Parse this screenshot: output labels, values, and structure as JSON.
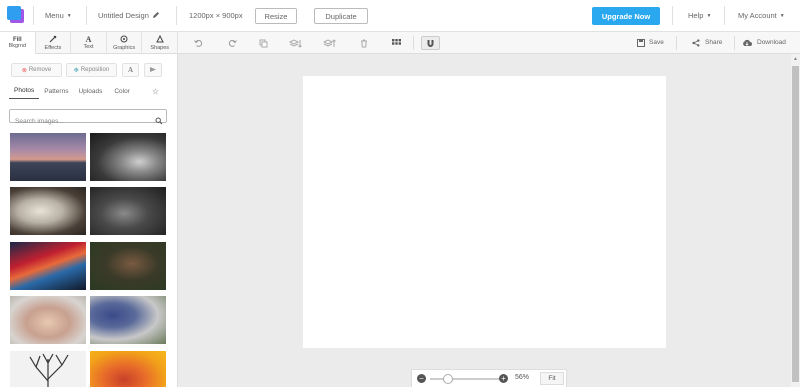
{
  "topbar": {
    "menu_label": "Menu",
    "design_name": "Untitled Design",
    "dimensions": "1200px × 900px",
    "resize_label": "Resize",
    "duplicate_label": "Duplicate",
    "upgrade_label": "Upgrade Now",
    "help_label": "Help",
    "account_label": "My Account"
  },
  "tabs": [
    {
      "label": "Bkgrnd",
      "icon": "background-icon"
    },
    {
      "label": "Effects",
      "icon": "wand-icon"
    },
    {
      "label": "Text",
      "icon": "text-icon"
    },
    {
      "label": "Graphics",
      "icon": "graphics-icon"
    },
    {
      "label": "Shapes",
      "icon": "shapes-icon"
    }
  ],
  "panel": {
    "remove_label": "Remove",
    "reposition_label": "Reposition",
    "subtabs": [
      "Photos",
      "Patterns",
      "Uploads",
      "Color"
    ],
    "search_placeholder": "Search images..."
  },
  "toolbar": {
    "save_label": "Save",
    "share_label": "Share",
    "download_label": "Download"
  },
  "zoom": {
    "percent": "56%",
    "fit_label": "Fit",
    "level": 0.56
  },
  "colors": {
    "accent": "#29a8ef",
    "logo_front": "#2f9ef0",
    "logo_back": "#a157e5"
  }
}
